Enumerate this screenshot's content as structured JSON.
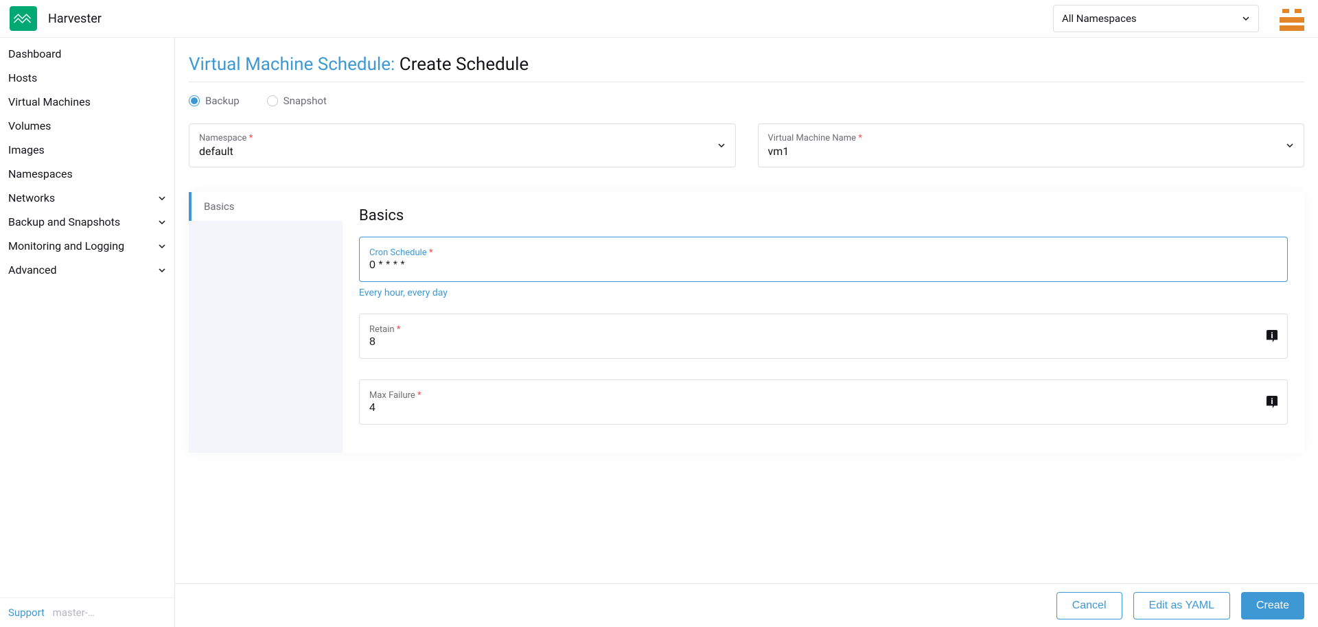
{
  "header": {
    "brand": "Harvester",
    "namespace_selector": "All Namespaces"
  },
  "sidebar": {
    "items": [
      {
        "label": "Dashboard",
        "expandable": false
      },
      {
        "label": "Hosts",
        "expandable": false
      },
      {
        "label": "Virtual Machines",
        "expandable": false
      },
      {
        "label": "Volumes",
        "expandable": false
      },
      {
        "label": "Images",
        "expandable": false
      },
      {
        "label": "Namespaces",
        "expandable": false
      },
      {
        "label": "Networks",
        "expandable": true
      },
      {
        "label": "Backup and Snapshots",
        "expandable": true
      },
      {
        "label": "Monitoring and Logging",
        "expandable": true
      },
      {
        "label": "Advanced",
        "expandable": true
      }
    ],
    "support": "Support",
    "version": "master-…"
  },
  "page": {
    "breadcrumb": "Virtual Machine Schedule:",
    "title": "Create Schedule",
    "radio": {
      "backup": "Backup",
      "snapshot": "Snapshot",
      "selected": "backup"
    },
    "namespace": {
      "label": "Namespace",
      "value": "default"
    },
    "vmname": {
      "label": "Virtual Machine Name",
      "value": "vm1"
    },
    "tab_label": "Basics",
    "section_title": "Basics",
    "cron": {
      "label": "Cron Schedule",
      "value": "0 * * * *",
      "hint": "Every hour, every day"
    },
    "retain": {
      "label": "Retain",
      "value": "8"
    },
    "maxfail": {
      "label": "Max Failure",
      "value": "4"
    }
  },
  "footer": {
    "cancel": "Cancel",
    "edit_yaml": "Edit as YAML",
    "create": "Create"
  }
}
